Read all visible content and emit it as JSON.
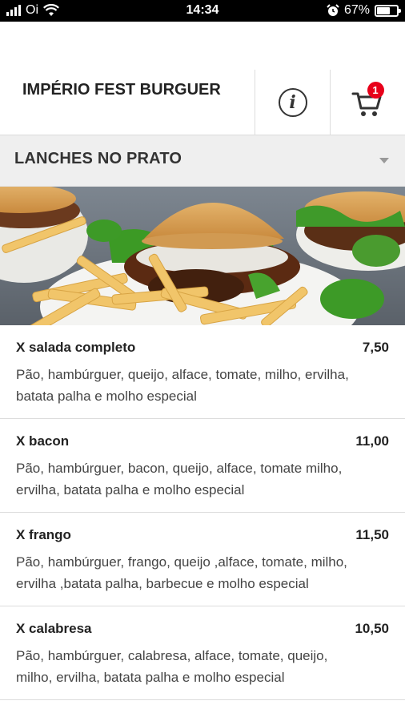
{
  "status_bar": {
    "carrier": "Oi",
    "time": "14:34",
    "battery_percent": "67%",
    "battery_level": 0.67,
    "icons": [
      "signal-icon",
      "wifi-icon",
      "alarm-icon",
      "battery-icon"
    ]
  },
  "header": {
    "title": "IMPÉRIO FEST BURGUER",
    "info_icon": "info-icon",
    "cart_icon": "cart-icon",
    "cart_count": "1",
    "badge_color": "#e8001a"
  },
  "category": {
    "label": "LANCHES NO PRATO",
    "caret_icon": "caret-down-icon"
  },
  "items": [
    {
      "name": "X salada completo",
      "price": "7,50",
      "description": "Pão, hambúrguer, queijo, alface, tomate, milho, ervilha, batata palha e molho especial"
    },
    {
      "name": "X bacon",
      "price": "11,00",
      "description": "Pão, hambúrguer, bacon, queijo, alface, tomate milho, ervilha, batata palha e molho especial"
    },
    {
      "name": "X frango",
      "price": "11,50",
      "description": "Pão, hambúrguer, frango, queijo ,alface, tomate, milho, ervilha ,batata palha, barbecue e molho especial"
    },
    {
      "name": "X calabresa",
      "price": "10,50",
      "description": "Pão, hambúrguer, calabresa, alface, tomate, queijo, milho, ervilha, batata palha e molho especial"
    }
  ]
}
